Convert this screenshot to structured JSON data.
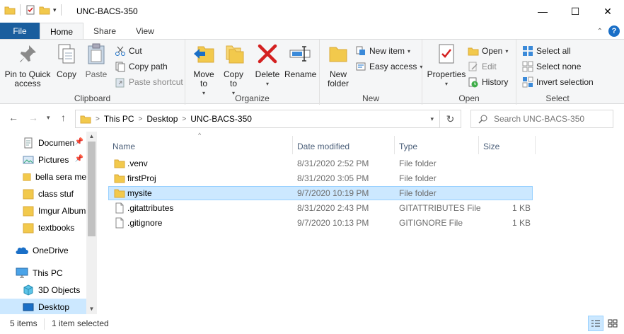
{
  "window": {
    "title": "UNC-BACS-350",
    "minimize_glyph": "—",
    "maximize_glyph": "☐",
    "close_glyph": "✕"
  },
  "tabs": [
    {
      "label": "File"
    },
    {
      "label": "Home"
    },
    {
      "label": "Share"
    },
    {
      "label": "View"
    }
  ],
  "help_glyph": "?",
  "ribbon": {
    "clipboard": {
      "label": "Clipboard",
      "pin": "Pin to Quick access",
      "copy": "Copy",
      "paste": "Paste",
      "cut": "Cut",
      "copy_path": "Copy path",
      "paste_shortcut": "Paste shortcut"
    },
    "organize": {
      "label": "Organize",
      "move_to": "Move to",
      "copy_to": "Copy to",
      "delete": "Delete",
      "rename": "Rename"
    },
    "new": {
      "label": "New",
      "new_folder": "New folder",
      "new_item": "New item",
      "easy_access": "Easy access"
    },
    "open": {
      "label": "Open",
      "properties": "Properties",
      "open": "Open",
      "edit": "Edit",
      "history": "History"
    },
    "select": {
      "label": "Select",
      "select_all": "Select all",
      "select_none": "Select none",
      "invert_selection": "Invert selection"
    }
  },
  "address": {
    "breadcrumbs": [
      "This PC",
      "Desktop",
      "UNC-BACS-350"
    ],
    "search_placeholder": "Search UNC-BACS-350"
  },
  "nav": {
    "items": [
      {
        "label": "Documen",
        "icon": "documents-icon",
        "pinned": true
      },
      {
        "label": "Pictures",
        "icon": "pictures-icon",
        "pinned": true
      },
      {
        "label": "bella sera me",
        "icon": "folder-icon",
        "pinned": false
      },
      {
        "label": "class stuf",
        "icon": "folder-icon",
        "pinned": false
      },
      {
        "label": "Imgur Album",
        "icon": "folder-icon",
        "pinned": false
      },
      {
        "label": "textbooks",
        "icon": "folder-icon",
        "pinned": false
      },
      {
        "label": "OneDrive",
        "icon": "onedrive-icon",
        "pinned": false
      },
      {
        "label": "This PC",
        "icon": "pc-icon",
        "pinned": false
      },
      {
        "label": "3D Objects",
        "icon": "3d-objects-icon",
        "pinned": false
      },
      {
        "label": "Desktop",
        "icon": "desktop-icon",
        "pinned": false
      }
    ],
    "pin_glyph": "📌"
  },
  "columns": {
    "name": "Name",
    "date": "Date modified",
    "type": "Type",
    "size": "Size"
  },
  "files": [
    {
      "name": ".venv",
      "date": "8/31/2020 2:52 PM",
      "type": "File folder",
      "size": "",
      "kind": "folder"
    },
    {
      "name": "firstProj",
      "date": "8/31/2020 3:05 PM",
      "type": "File folder",
      "size": "",
      "kind": "folder"
    },
    {
      "name": "mysite",
      "date": "9/7/2020 10:19 PM",
      "type": "File folder",
      "size": "",
      "kind": "folder"
    },
    {
      "name": ".gitattributes",
      "date": "8/31/2020 2:43 PM",
      "type": "GITATTRIBUTES File",
      "size": "1 KB",
      "kind": "file"
    },
    {
      "name": ".gitignore",
      "date": "9/7/2020 10:13 PM",
      "type": "GITIGNORE File",
      "size": "1 KB",
      "kind": "file"
    }
  ],
  "selected_file": "mysite",
  "status": {
    "count": "5 items",
    "selection": "1 item selected"
  },
  "colors": {
    "accent": "#1a5e9e",
    "selection": "#cce8ff",
    "folder": "#f2c94c",
    "delete_red": "#d42020"
  }
}
